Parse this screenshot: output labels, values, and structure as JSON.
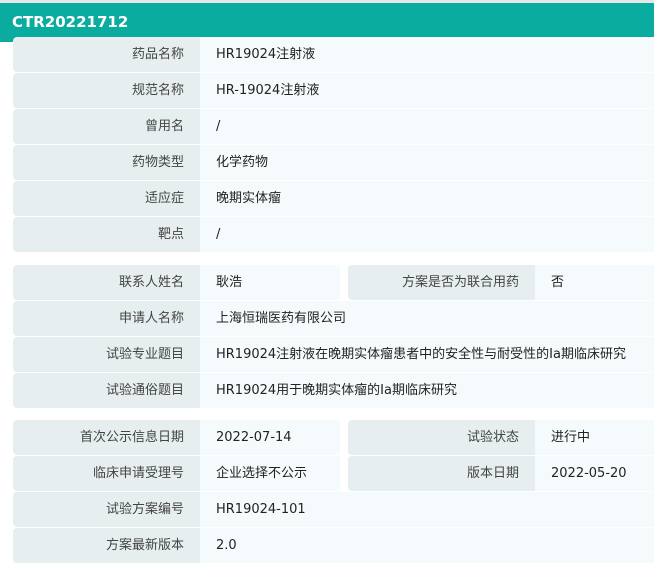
{
  "header": {
    "title": "CTR20221712"
  },
  "group1": [
    {
      "label": "药品名称",
      "value": "HR19024注射液"
    },
    {
      "label": "规范名称",
      "value": "HR-19024注射液"
    },
    {
      "label": "曾用名",
      "value": "/"
    },
    {
      "label": "药物类型",
      "value": "化学药物"
    },
    {
      "label": "适应症",
      "value": "晚期实体瘤"
    },
    {
      "label": "靶点",
      "value": "/"
    }
  ],
  "group2": {
    "contact": {
      "label": "联系人姓名",
      "value": "耿浩",
      "label2": "方案是否为联合用药",
      "value2": "否"
    },
    "rows": [
      {
        "label": "申请人名称",
        "value": "上海恒瑞医药有限公司"
      },
      {
        "label": "试验专业题目",
        "value": "HR19024注射液在晚期实体瘤患者中的安全性与耐受性的Ia期临床研究"
      },
      {
        "label": "试验通俗题目",
        "value": "HR19024用于晚期实体瘤的Ia期临床研究"
      }
    ]
  },
  "group3": {
    "r1": {
      "label": "首次公示信息日期",
      "value": "2022-07-14",
      "label2": "试验状态",
      "value2": "进行中"
    },
    "r2": {
      "label": "临床申请受理号",
      "value": "企业选择不公示",
      "label2": "版本日期",
      "value2": "2022-05-20"
    },
    "rows": [
      {
        "label": "试验方案编号",
        "value": "HR19024-101"
      },
      {
        "label": "方案最新版本",
        "value": "2.0"
      }
    ]
  }
}
